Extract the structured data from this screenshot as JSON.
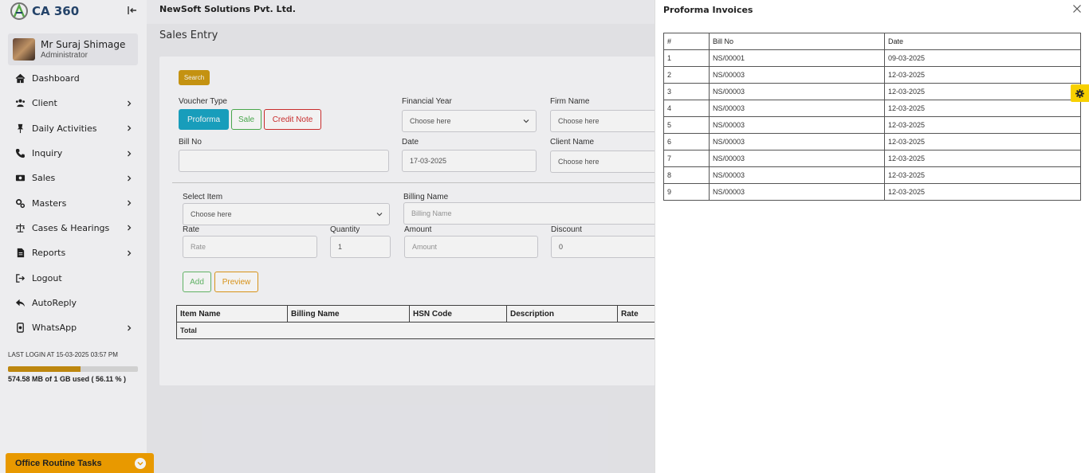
{
  "app": {
    "logo_text": "CA 360"
  },
  "user": {
    "name": "Mr Suraj Shimage",
    "role": "Administrator"
  },
  "nav": [
    {
      "label": "Dashboard",
      "icon": "home-icon",
      "has_children": false
    },
    {
      "label": "Client",
      "icon": "users-icon",
      "has_children": true
    },
    {
      "label": "Daily Activities",
      "icon": "pin-icon",
      "has_children": true
    },
    {
      "label": "Inquiry",
      "icon": "phone-icon",
      "has_children": true
    },
    {
      "label": "Sales",
      "icon": "cash-icon",
      "has_children": true
    },
    {
      "label": "Masters",
      "icon": "cogs-icon",
      "has_children": true
    },
    {
      "label": "Cases & Hearings",
      "icon": "scale-icon",
      "has_children": true
    },
    {
      "label": "Reports",
      "icon": "file-icon",
      "has_children": true
    },
    {
      "label": "Logout",
      "icon": "logout-icon",
      "has_children": false
    },
    {
      "label": "AutoReply",
      "icon": "reply-icon",
      "has_children": false
    },
    {
      "label": "WhatsApp",
      "icon": "whatsapp-icon",
      "has_children": true
    }
  ],
  "last_login": "LAST LOGIN AT 15-03-2025 03:57 PM",
  "storage": {
    "used_fraction": 0.5611,
    "text": "574.58 MB of 1 GB used ( 56.11 % )"
  },
  "routine": {
    "label": "Office Routine Tasks"
  },
  "header": {
    "company": "NewSoft Solutions Pvt. Ltd."
  },
  "page": {
    "title": "Sales Entry"
  },
  "form": {
    "search_label": "Search",
    "voucher_type_label": "Voucher Type",
    "voucher_types": {
      "proforma": "Proforma",
      "sale": "Sale",
      "credit_note": "Credit Note"
    },
    "financial_year": {
      "label": "Financial Year",
      "placeholder": "Choose here"
    },
    "firm_name": {
      "label": "Firm Name",
      "placeholder": "Choose here"
    },
    "bill_no": {
      "label": "Bill No",
      "value": ""
    },
    "date": {
      "label": "Date",
      "value": "17-03-2025"
    },
    "client_name": {
      "label": "Client Name",
      "placeholder": "Choose here"
    },
    "select_item": {
      "label": "Select Item",
      "placeholder": "Choose here"
    },
    "billing_name": {
      "label": "Billing Name",
      "placeholder": "Billing Name"
    },
    "rate": {
      "label": "Rate",
      "placeholder": "Rate"
    },
    "quantity": {
      "label": "Quantity",
      "value": "1"
    },
    "amount": {
      "label": "Amount",
      "placeholder": "Amount"
    },
    "discount": {
      "label": "Discount",
      "value": "0"
    },
    "add_label": "Add",
    "preview_label": "Preview"
  },
  "items_table": {
    "columns": [
      "Item Name",
      "Billing Name",
      "HSN Code",
      "Description",
      "Rate"
    ],
    "total_label": "Total"
  },
  "drawer": {
    "title": "Proforma Invoices",
    "columns": [
      "#",
      "Bill No",
      "Date"
    ],
    "rows": [
      [
        "1",
        "NS/00001",
        "09-03-2025"
      ],
      [
        "2",
        "NS/00003",
        "12-03-2025"
      ],
      [
        "3",
        "NS/00003",
        "12-03-2025"
      ],
      [
        "4",
        "NS/00003",
        "12-03-2025"
      ],
      [
        "5",
        "NS/00003",
        "12-03-2025"
      ],
      [
        "6",
        "NS/00003",
        "12-03-2025"
      ],
      [
        "7",
        "NS/00003",
        "12-03-2025"
      ],
      [
        "8",
        "NS/00003",
        "12-03-2025"
      ],
      [
        "9",
        "NS/00003",
        "12-03-2025"
      ]
    ]
  },
  "colors": {
    "accent_gold": "#cf9a12",
    "proforma": "#1aa6c6",
    "sale": "#4caf50",
    "credit_note": "#d32f2f",
    "routine": "#f5a200",
    "settings_button": "#f7d000"
  }
}
